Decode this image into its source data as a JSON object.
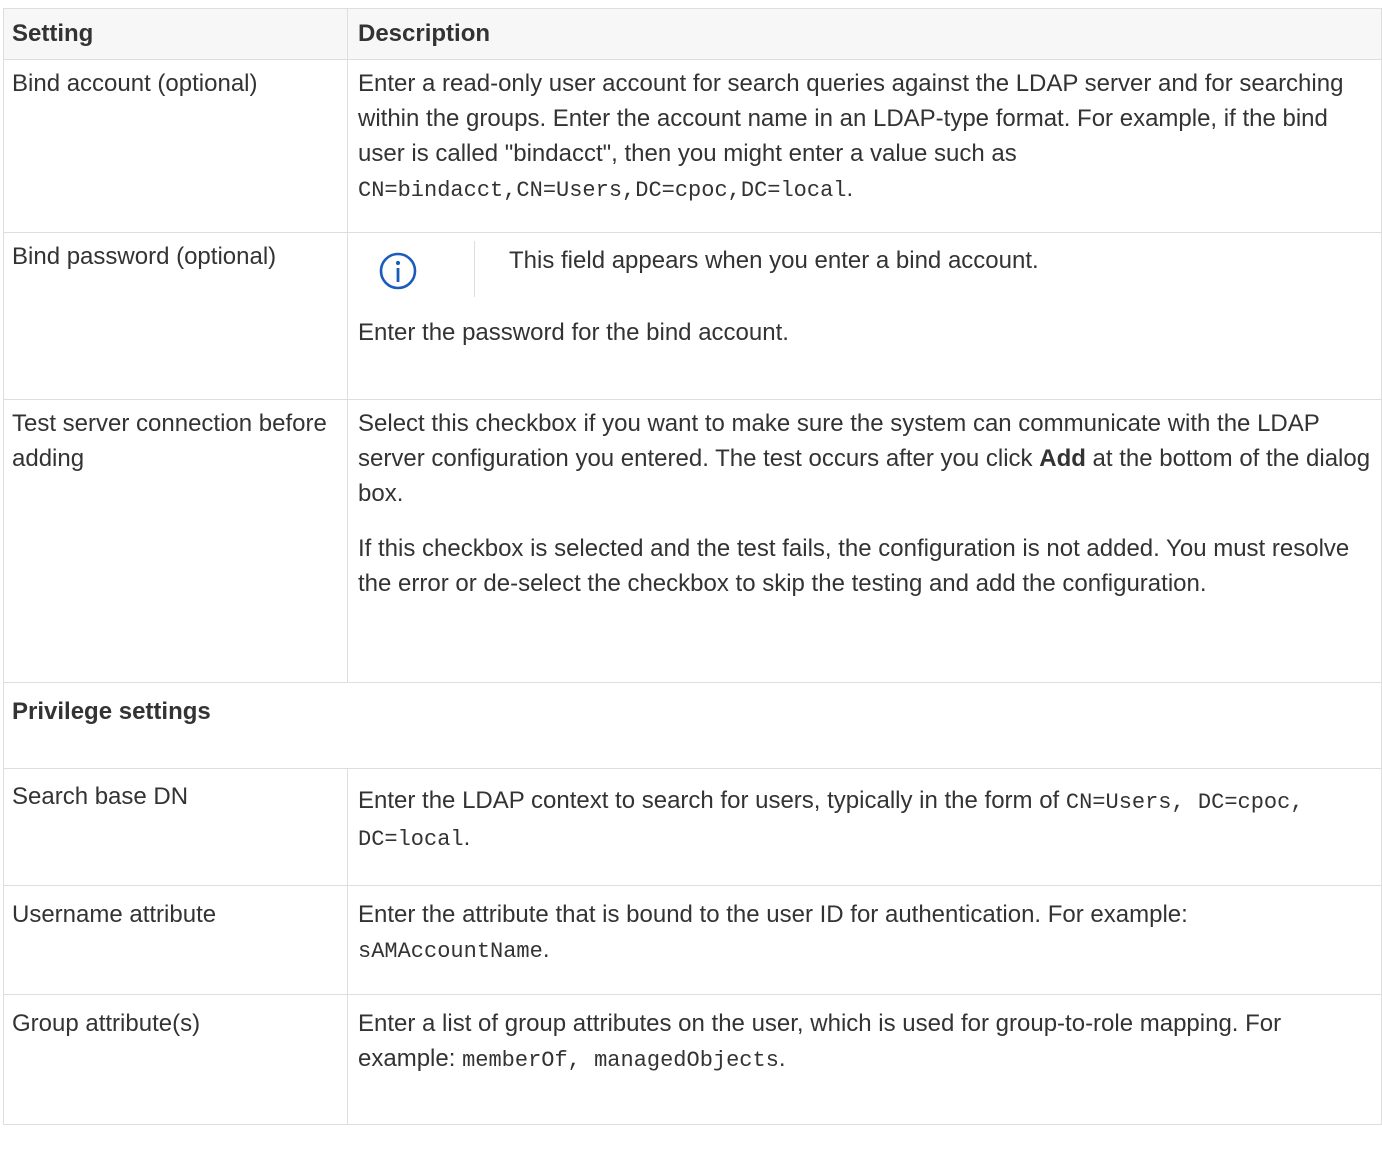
{
  "table": {
    "headers": [
      "Setting",
      "Description"
    ],
    "rows": {
      "bind_account": {
        "setting": "Bind account (optional)",
        "desc_a": "Enter a read-only user account for search queries against the LDAP server and for searching within the groups. Enter the account name in an LDAP-type format. For example, if the bind user is called \"bindacct\", then you might enter a value such as ",
        "desc_code": "CN=bindacct,CN=Users,DC=cpoc,DC=local",
        "desc_end": "."
      },
      "bind_password": {
        "setting": "Bind password (optional)",
        "note": "This field appears when you enter a bind account.",
        "note_icon": "info-circle-icon",
        "desc": "Enter the password for the bind account."
      },
      "test_connection": {
        "setting": "Test server connection before adding",
        "p1_a": "Select this checkbox if you want to make sure the system can communicate with the LDAP server configuration you entered. The test occurs after you click ",
        "p1_bold": "Add",
        "p1_b": " at the bottom of the dialog box.",
        "p2": "If this checkbox is selected and the test fails, the configuration is not added. You must resolve the error or de-select the checkbox to skip the testing and add the configuration."
      },
      "privilege_section": {
        "title": "Privilege settings"
      },
      "search_base": {
        "setting": "Search base DN",
        "desc_a": "Enter the LDAP context to search for users, typically in the form of ",
        "desc_code": "CN=Users, DC=cpoc, DC=local",
        "desc_end": "."
      },
      "username_attr": {
        "setting": "Username attribute",
        "desc_a": "Enter the attribute that is bound to the user ID for authentication. For example: ",
        "desc_code": "sAMAccountName",
        "desc_end": "."
      },
      "group_attr": {
        "setting": "Group attribute(s)",
        "desc_a": "Enter a list of group attributes on the user, which is used for group-to-role mapping. For example: ",
        "desc_code": "memberOf, managedObjects",
        "desc_end": "."
      }
    }
  },
  "colors": {
    "info_icon": "#1a5bbd",
    "border": "#dedede",
    "header_bg": "#f7f7f8",
    "text": "#333333"
  }
}
